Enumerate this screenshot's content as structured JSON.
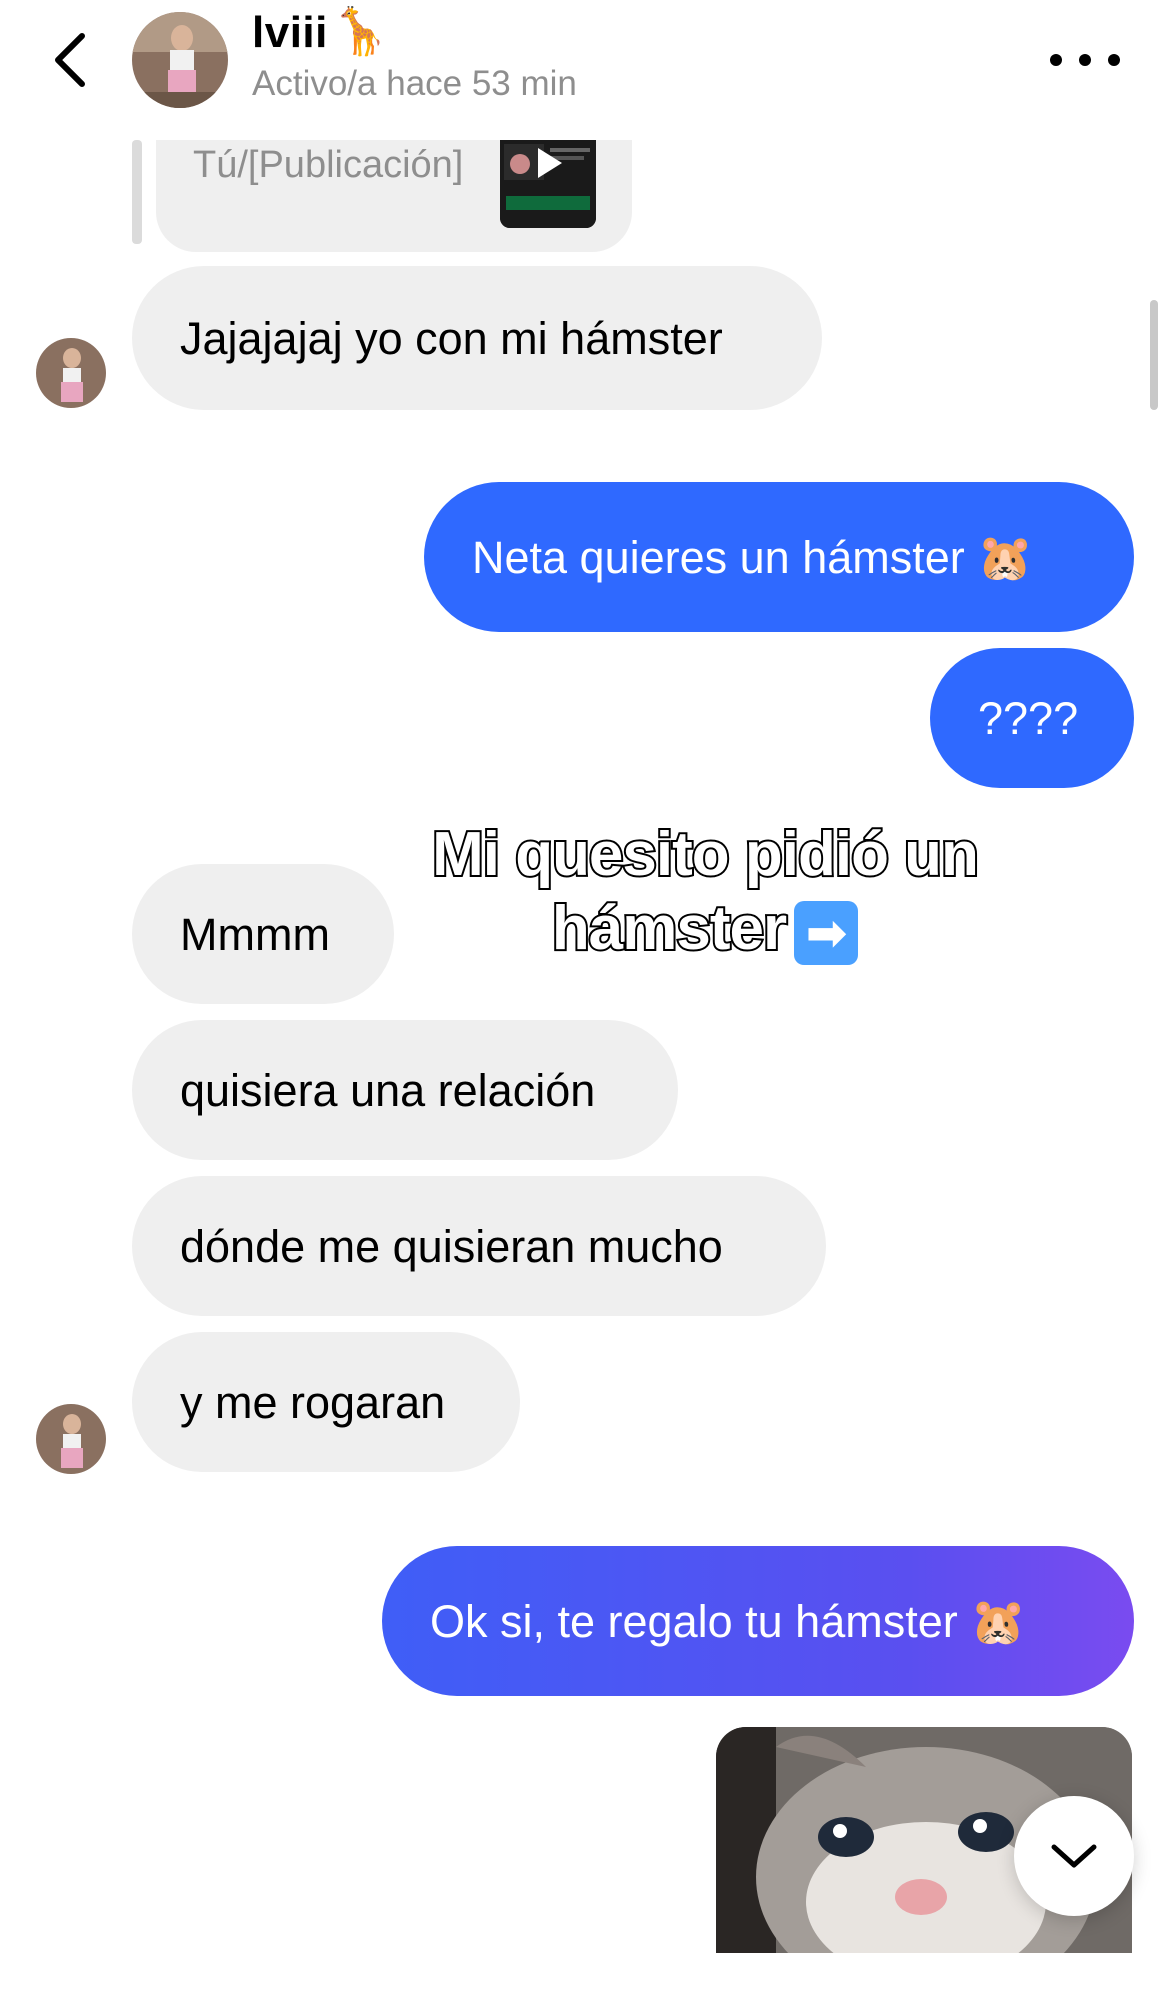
{
  "header": {
    "contact_name": "lviii",
    "name_emoji": "🦒",
    "status": "Activo/a hace 53 min"
  },
  "reply_preview": {
    "label": "Tú/[Publicación]"
  },
  "messages": [
    {
      "from": "contact",
      "text": "Jajajajaj yo con mi hámster"
    },
    {
      "from": "me",
      "text": "Neta quieres un hámster 🐹"
    },
    {
      "from": "me",
      "text": "????"
    },
    {
      "from": "contact",
      "text": "Mmmm"
    },
    {
      "from": "contact",
      "text": "quisiera una relación"
    },
    {
      "from": "contact",
      "text": "dónde me quisieran mucho"
    },
    {
      "from": "contact",
      "text": "y me rogaran"
    },
    {
      "from": "me",
      "text": "Ok si, te regalo tu hámster 🐹"
    }
  ],
  "overlay": {
    "line1": "Mi quesito pidió un",
    "line2": "hámster",
    "arrow": "➡"
  },
  "colors": {
    "sent_bubble": "#2f69ff",
    "received_bubble": "#efefef",
    "status_text": "#8e8e8e"
  },
  "icons": [
    "back-arrow-icon",
    "more-options-icon",
    "chevron-down-icon",
    "play-icon"
  ]
}
